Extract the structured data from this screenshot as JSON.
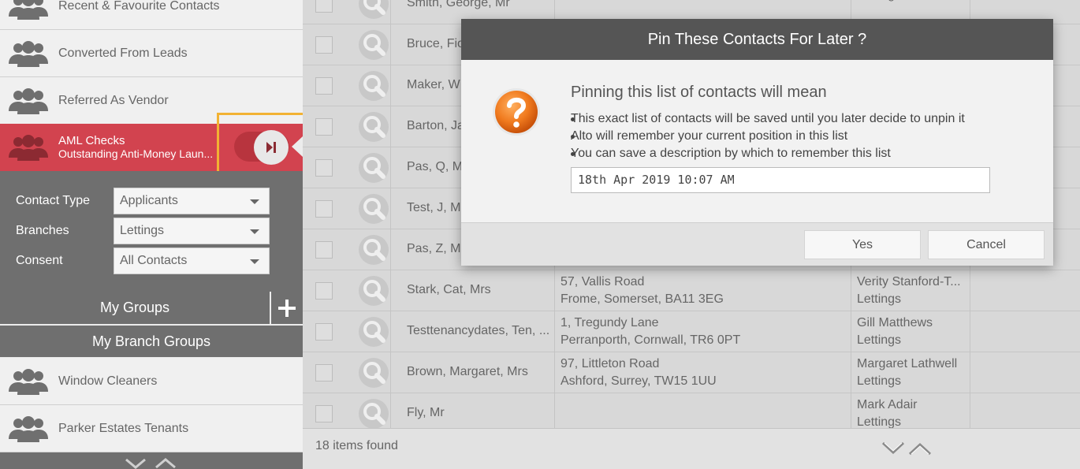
{
  "sidebar": {
    "groups_top": [
      {
        "label": "Recent & Favourite Contacts"
      },
      {
        "label": "Converted From Leads"
      },
      {
        "label": "Referred As Vendor"
      }
    ],
    "active_group": {
      "title": "AML Checks",
      "subtitle": "Outstanding Anti-Money Laun..."
    },
    "filters": [
      {
        "label": "Contact Type",
        "value": "Applicants"
      },
      {
        "label": "Branches",
        "value": "Lettings"
      },
      {
        "label": "Consent",
        "value": "All Contacts"
      }
    ],
    "my_groups_label": "My Groups",
    "my_branch_groups_label": "My Branch Groups",
    "branch_groups": [
      {
        "label": "Window Cleaners"
      },
      {
        "label": "Parker Estates Tenants"
      }
    ]
  },
  "table": {
    "rows": [
      {
        "name": "Smith, George, Mr",
        "addr1": "",
        "addr2": "",
        "nego1": "",
        "nego2": "Lettings"
      },
      {
        "name": "Bruce, Fio",
        "addr1": "",
        "addr2": "",
        "nego1": "",
        "nego2": ""
      },
      {
        "name": "Maker, W",
        "addr1": "",
        "addr2": "",
        "nego1": "",
        "nego2": ""
      },
      {
        "name": "Barton, Ja",
        "addr1": "",
        "addr2": "",
        "nego1": "",
        "nego2": ""
      },
      {
        "name": "Pas, Q, Mr",
        "addr1": "",
        "addr2": "",
        "nego1": "",
        "nego2": ""
      },
      {
        "name": "Test, J, Mr",
        "addr1": "",
        "addr2": "",
        "nego1": "",
        "nego2": ""
      },
      {
        "name": "Pas, Z, Mr",
        "addr1": "",
        "addr2": "",
        "nego1": "",
        "nego2": ""
      },
      {
        "name": "Stark, Cat, Mrs",
        "addr1": "57, Vallis Road",
        "addr2": "Frome, Somerset, BA11 3EG",
        "nego1": "Verity Stanford-T...",
        "nego2": "Lettings"
      },
      {
        "name": "Testtenancydates, Ten, ...",
        "addr1": "1, Tregundy Lane",
        "addr2": "Perranporth, Cornwall, TR6 0PT",
        "nego1": "Gill Matthews",
        "nego2": "Lettings"
      },
      {
        "name": "Brown, Margaret, Mrs",
        "addr1": "97, Littleton Road",
        "addr2": "Ashford, Surrey, TW15 1UU",
        "nego1": "Margaret Lathwell",
        "nego2": "Lettings"
      },
      {
        "name": "Fly, Mr",
        "addr1": "",
        "addr2": "",
        "nego1": "Mark Adair",
        "nego2": "Lettings"
      }
    ],
    "items_found": "18 items found"
  },
  "modal": {
    "title": "Pin These Contacts For Later ?",
    "heading": "Pinning this list of contacts will mean",
    "bullets": [
      "This exact list of contacts will be saved until you later decide to unpin it",
      "Alto will remember your current position in this list",
      "You can save a description by which to remember this list"
    ],
    "description_value": "18th Apr 2019 10:07 AM",
    "yes_label": "Yes",
    "cancel_label": "Cancel"
  },
  "colors": {
    "active_group": "#d2434f",
    "panel_grey": "#6f6f6f",
    "modal_header": "#555555",
    "highlight": "#f2b233",
    "question_orange": "#f07a1e"
  }
}
